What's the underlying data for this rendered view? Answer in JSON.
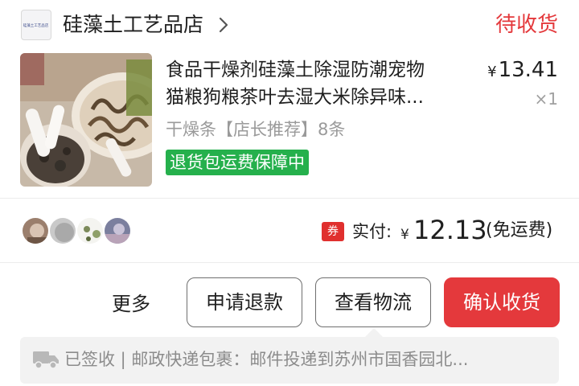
{
  "store": {
    "logo_text": "硅藻土工艺品店",
    "name": "硅藻土工艺品店",
    "chevron_icon": "chevron-right-icon"
  },
  "order": {
    "status": "待收货"
  },
  "product": {
    "title_line1": "食品干燥剂硅藻土除湿防潮宠物",
    "title_line2": "猫粮狗粮茶叶去湿大米除异味...",
    "price_symbol": "¥",
    "price": "13.41",
    "quantity": "×1",
    "spec": "干燥条【店长推荐】8条",
    "guarantee": "退货包运费保障中"
  },
  "payment": {
    "coupon_label": "券",
    "label": "实付:",
    "currency": "¥",
    "amount": "12.13",
    "note": "(免运费)"
  },
  "actions": {
    "more": "更多",
    "refund": "申请退款",
    "logistics": "查看物流",
    "confirm": "确认收货"
  },
  "logistics": {
    "icon": "truck-icon",
    "text": "已签收 | 邮政快递包裹：邮件投递到苏州市国香园北..."
  },
  "colors": {
    "accent": "#e4393c",
    "guarantee_green": "#25b04c",
    "muted_text": "#9a9a9a",
    "logistics_bg": "#f2f2f2"
  }
}
